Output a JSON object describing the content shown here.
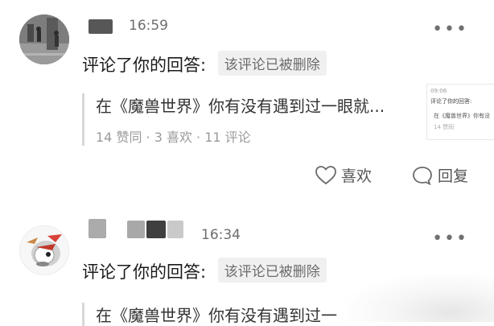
{
  "notifications": [
    {
      "time": "16:59",
      "action": "评论了你的回答:",
      "tag": "该评论已被删除",
      "quote_title": "在《魔兽世界》你有没有遇到过一眼就...",
      "stats": "14 赞同 · 3 喜欢 · 11 评论",
      "thumb": {
        "time": "09:06",
        "action": "评论了你的回答:",
        "title": "在《魔兽世界》你有没",
        "stats": "14 赞同"
      },
      "like_label": "喜欢",
      "reply_label": "回复"
    },
    {
      "time": "16:34",
      "action": "评论了你的回答:",
      "tag": "该评论已被删除",
      "quote_title": "在《魔兽世界》你有没有遇到过一"
    }
  ],
  "colors": {
    "text": "#1a1a1a",
    "muted": "#9a9a9a",
    "tag_bg": "#f0f0f0"
  }
}
